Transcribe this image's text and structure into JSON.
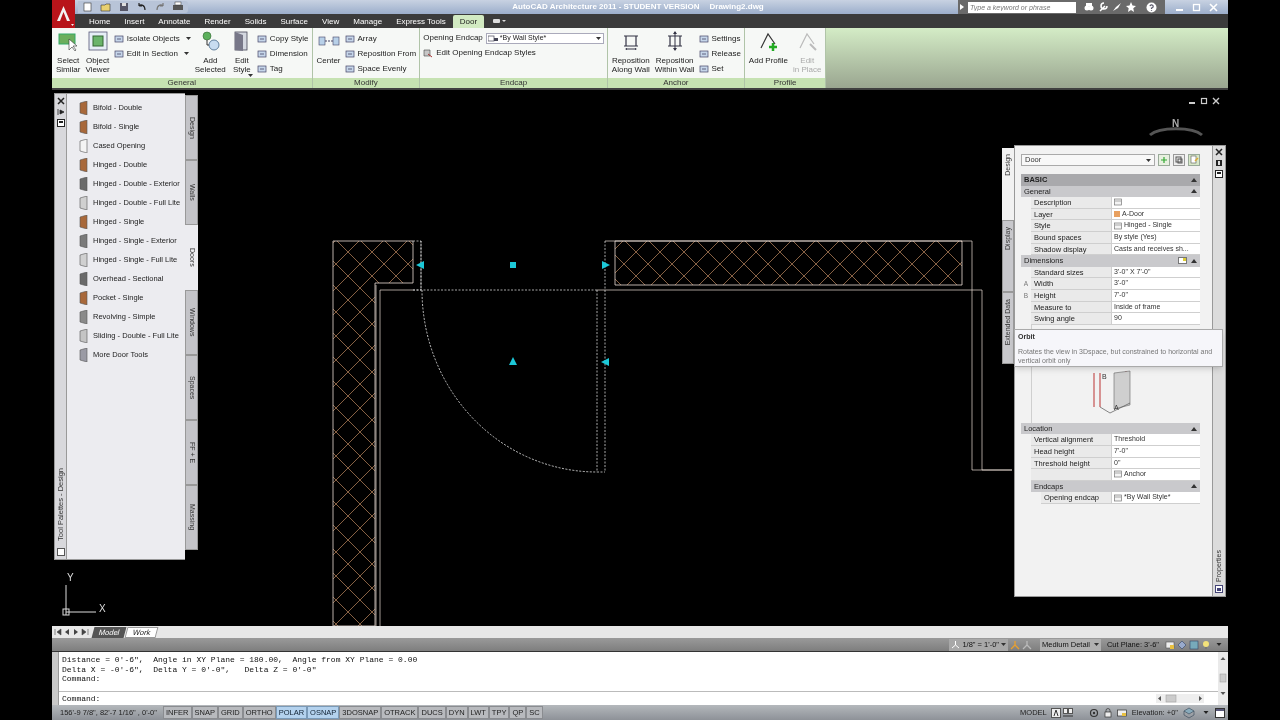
{
  "title_bar": {
    "title": "AutoCAD Architecture 2011 - STUDENT VERSION",
    "file_name": "Drawing2.dwg"
  },
  "search": {
    "placeholder": "Type a keyword or phrase"
  },
  "ribbon_tabs": [
    {
      "label": "Home",
      "selected": false
    },
    {
      "label": "Insert",
      "selected": false
    },
    {
      "label": "Annotate",
      "selected": false
    },
    {
      "label": "Render",
      "selected": false
    },
    {
      "label": "Solids",
      "selected": false
    },
    {
      "label": "Surface",
      "selected": false
    },
    {
      "label": "View",
      "selected": false
    },
    {
      "label": "Manage",
      "selected": false
    },
    {
      "label": "Express Tools",
      "selected": false
    },
    {
      "label": "Door",
      "selected": true
    }
  ],
  "ribbon_panels": [
    {
      "title": "General",
      "tools": [
        {
          "kind": "large",
          "label": "Select\nSimilar",
          "dropdown": false,
          "disabled": false
        },
        {
          "kind": "large",
          "label": "Object\nViewer",
          "dropdown": false,
          "disabled": false
        },
        {
          "kind": "stack",
          "items": [
            {
              "label": "Isolate Objects",
              "dropdown": true
            },
            {
              "label": "Edit in Section",
              "dropdown": true
            }
          ]
        },
        {
          "kind": "large",
          "label": "Add\nSelected",
          "dropdown": false,
          "disabled": false
        },
        {
          "kind": "large",
          "label": "Edit\nStyle",
          "dropdown": true,
          "disabled": false
        },
        {
          "kind": "stack",
          "items": [
            {
              "label": "Copy Style",
              "dropdown": false
            },
            {
              "label": "Dimension",
              "dropdown": false
            },
            {
              "label": "Tag",
              "dropdown": false
            }
          ]
        }
      ]
    },
    {
      "title": "Modify",
      "tools": [
        {
          "kind": "large",
          "label": "Center",
          "dropdown": false,
          "disabled": false
        },
        {
          "kind": "stack",
          "items": [
            {
              "label": "Array",
              "dropdown": false
            },
            {
              "label": "Reposition From",
              "dropdown": false
            },
            {
              "label": "Space Evenly",
              "dropdown": false
            }
          ]
        }
      ]
    },
    {
      "title": "Endcap",
      "tools": [
        {
          "kind": "combo",
          "label": "Opening Endcap",
          "value": "*By Wall Style*",
          "items": [
            {
              "label": "Edit Opening Endcap Styles",
              "dropdown": false
            }
          ]
        }
      ]
    },
    {
      "title": "Anchor",
      "tools": [
        {
          "kind": "large",
          "label": "Reposition\nAlong Wall",
          "dropdown": false,
          "disabled": false
        },
        {
          "kind": "large",
          "label": "Reposition\nWithin Wall",
          "dropdown": false,
          "disabled": false
        },
        {
          "kind": "stack",
          "items": [
            {
              "label": "Settings",
              "dropdown": false
            },
            {
              "label": "Release",
              "dropdown": false
            },
            {
              "label": "Set",
              "dropdown": false
            }
          ]
        }
      ]
    },
    {
      "title": "Profile",
      "tools": [
        {
          "kind": "large",
          "label": "Add Profile",
          "dropdown": false,
          "disabled": false
        },
        {
          "kind": "large",
          "label": "Edit\nin Place",
          "dropdown": false,
          "disabled": true
        }
      ]
    }
  ],
  "tool_palette": {
    "title": "Tool Palettes - Design",
    "items": [
      {
        "label": "Bifold - Double"
      },
      {
        "label": "Bifold - Single"
      },
      {
        "label": "Cased Opening"
      },
      {
        "label": "Hinged - Double"
      },
      {
        "label": "Hinged - Double - Exterior"
      },
      {
        "label": "Hinged - Double - Full Lite"
      },
      {
        "label": "Hinged - Single"
      },
      {
        "label": "Hinged - Single - Exterior"
      },
      {
        "label": "Hinged - Single - Full Lite"
      },
      {
        "label": "Overhead - Sectional"
      },
      {
        "label": "Pocket - Single"
      },
      {
        "label": "Revolving - Simple"
      },
      {
        "label": "Sliding - Double - Full Lite"
      },
      {
        "label": "More Door Tools"
      }
    ],
    "tabs": [
      {
        "label": "Design",
        "selected": false
      },
      {
        "label": "Walls",
        "selected": false
      },
      {
        "label": "Doors",
        "selected": true
      },
      {
        "label": "Windows",
        "selected": false
      },
      {
        "label": "Spaces",
        "selected": false
      },
      {
        "label": "FF + E",
        "selected": false
      },
      {
        "label": "Massing",
        "selected": false
      }
    ]
  },
  "viewcube": {
    "label": "N"
  },
  "ucs": {
    "y_label": "Y",
    "x_label": "X"
  },
  "properties": {
    "object_type": "Door",
    "title": "Properties",
    "side_tabs": [
      {
        "label": "Design",
        "selected": true
      },
      {
        "label": "Display",
        "selected": false
      },
      {
        "label": "Extended Data",
        "selected": false
      }
    ],
    "rows": [
      {
        "kind": "category",
        "label": "BASIC",
        "expanded": true
      },
      {
        "kind": "group",
        "label": "General",
        "expanded": true
      },
      {
        "kind": "field",
        "label": "Description",
        "icon": true
      },
      {
        "kind": "field",
        "label": "Layer",
        "value": "A-Door",
        "color": "#e8a060"
      },
      {
        "kind": "field",
        "label": "Style",
        "value": "Hinged - Single",
        "icon": true
      },
      {
        "kind": "field",
        "label": "Bound spaces",
        "value": "By style (Yes)"
      },
      {
        "kind": "field",
        "label": "Shadow display",
        "value": "Casts and receives sh..."
      },
      {
        "kind": "group",
        "label": "Dimensions",
        "expanded": true,
        "icon": true
      },
      {
        "kind": "field",
        "label": "Standard sizes",
        "value": "3'-0\" X 7'-0\""
      },
      {
        "kind": "field",
        "marker": "A",
        "label": "Width",
        "value": "3'-0\""
      },
      {
        "kind": "field",
        "marker": "B",
        "label": "Height",
        "value": "7'-0\""
      },
      {
        "kind": "field",
        "label": "Measure to",
        "value": "Inside of frame"
      },
      {
        "kind": "field",
        "label": "Swing angle",
        "value": "90"
      },
      {
        "kind": "diagram",
        "labels": [
          "B",
          "A"
        ]
      },
      {
        "kind": "group",
        "label": "Location",
        "expanded": true
      },
      {
        "kind": "field",
        "label": "Vertical alignment",
        "value": "Threshold"
      },
      {
        "kind": "field",
        "label": "Head height",
        "value": "7'-0\""
      },
      {
        "kind": "field",
        "label": "Threshold height",
        "value": "0\""
      },
      {
        "kind": "field",
        "value": "Anchor",
        "icon": true
      },
      {
        "kind": "subgroup",
        "label": "Endcaps",
        "expanded": true
      },
      {
        "kind": "subfield",
        "label": "Opening endcap",
        "value": "*By Wall Style*",
        "icon": true
      }
    ]
  },
  "tooltip": {
    "title": "Orbit",
    "text": "Rotates the view in 3Dspace, but constrained to horizontal and vertical orbit only"
  },
  "layout_tabs": [
    {
      "label": "Model",
      "selected": true
    },
    {
      "label": "Work",
      "selected": false
    }
  ],
  "drawing_status": {
    "scale": "1/8\" = 1'-0\"",
    "detail": "Medium Detail",
    "cut_plane": "Cut Plane: 3'-6\""
  },
  "command_line": {
    "history": [
      "Distance = 0'-6\",  Angle in XY Plane = 180.00,  Angle from XY Plane = 0.00",
      "Delta X = -0'-6\",  Delta Y = 0'-0\",   Delta Z = 0'-0\"",
      "Command:"
    ],
    "prompt": "Command:"
  },
  "status_bar": {
    "coordinates": "156'-9 7/8\", 82'-7 1/16\" , 0'-0\"",
    "toggles": [
      {
        "label": "INFER",
        "on": false
      },
      {
        "label": "SNAP",
        "on": false
      },
      {
        "label": "GRID",
        "on": false
      },
      {
        "label": "ORTHO",
        "on": false
      },
      {
        "label": "POLAR",
        "on": true
      },
      {
        "label": "OSNAP",
        "on": true
      },
      {
        "label": "3DOSNAP",
        "on": false
      },
      {
        "label": "OTRACK",
        "on": false
      },
      {
        "label": "DUCS",
        "on": false
      },
      {
        "label": "DYN",
        "on": false
      },
      {
        "label": "LWT",
        "on": false
      },
      {
        "label": "TPY",
        "on": false
      },
      {
        "label": "QP",
        "on": false
      },
      {
        "label": "SC",
        "on": false
      }
    ],
    "space": "MODEL",
    "elevation": "Elevation: +0\""
  }
}
